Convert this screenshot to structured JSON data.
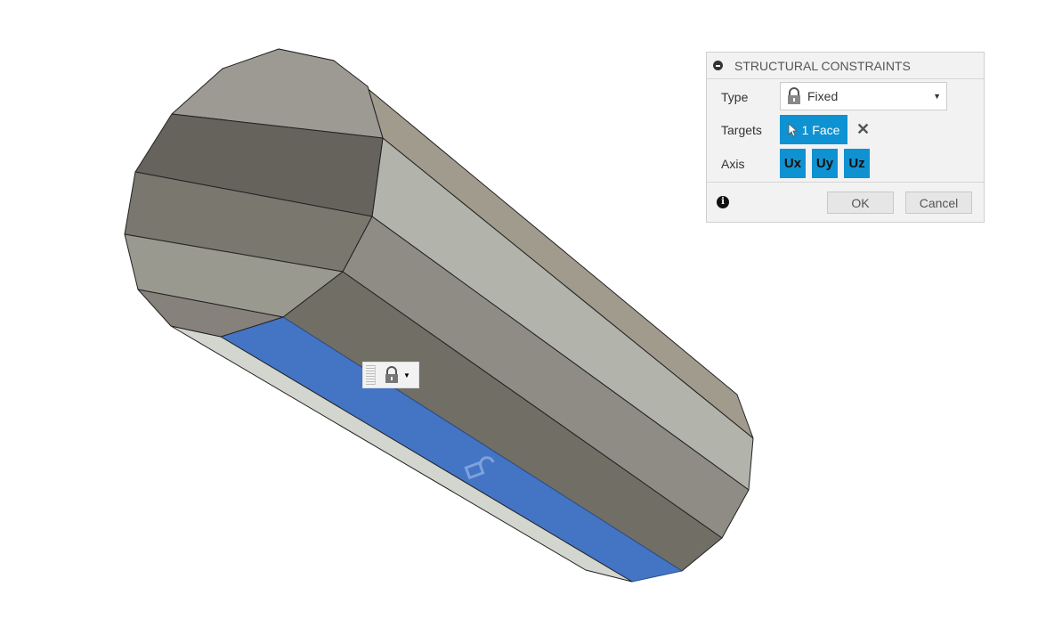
{
  "dialog": {
    "title": "STRUCTURAL CONSTRAINTS",
    "type_label": "Type",
    "type_value": "Fixed",
    "targets_label": "Targets",
    "targets_value": "1 Face",
    "axis_label": "Axis",
    "axis_buttons": [
      "Ux",
      "Uy",
      "Uz"
    ],
    "ok": "OK",
    "cancel": "Cancel",
    "accent": "#0f92d2"
  },
  "viewport": {
    "selected_face_color": "#4375c4",
    "constraint_icon": "lock-icon"
  }
}
